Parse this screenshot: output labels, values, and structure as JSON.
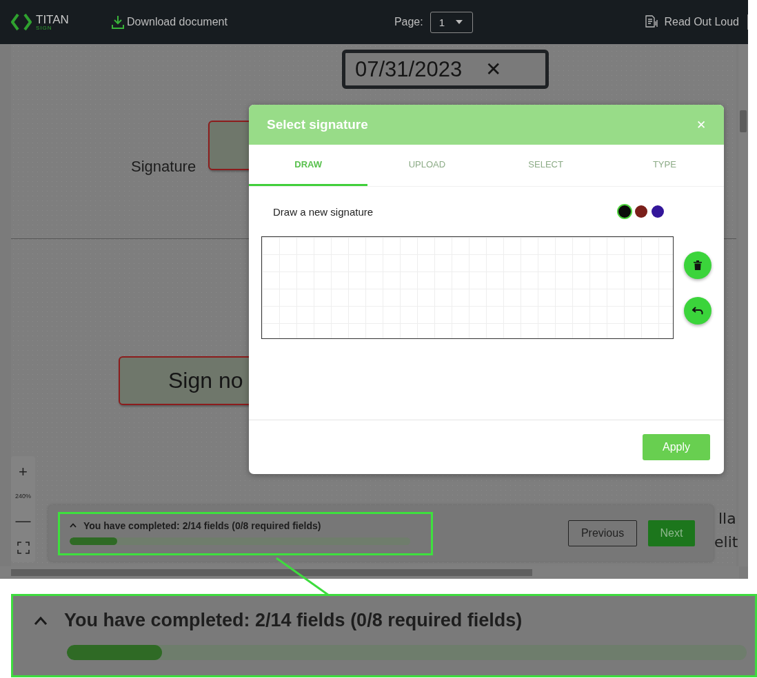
{
  "header": {
    "logo": {
      "name": "TITAN",
      "sub": "SIGN"
    },
    "download": "Download document",
    "page_label": "Page:",
    "page_value": "1",
    "read_aloud": "Read Out Loud"
  },
  "document": {
    "date_value": "07/31/2023",
    "date_clear": "✕",
    "signature_label": "Signature",
    "sign_button": "Sign no",
    "fragments": [
      "lla",
      "elit"
    ]
  },
  "zoom": {
    "plus": "+",
    "level": "240%",
    "minus": "—"
  },
  "modal": {
    "title": "Select signature",
    "close": "✕",
    "tabs": [
      {
        "label": "DRAW",
        "selected": true
      },
      {
        "label": "UPLOAD",
        "selected": false
      },
      {
        "label": "SELECT",
        "selected": false
      },
      {
        "label": "TYPE",
        "selected": false
      }
    ],
    "prompt": "Draw a new signature",
    "colors": [
      {
        "color": "#0a0a0a",
        "selected": true
      },
      {
        "color": "#7a1f1a",
        "selected": false
      },
      {
        "color": "#33169a",
        "selected": false
      }
    ],
    "apply": "Apply"
  },
  "progress": {
    "text": "You have completed: 2/14 fields (0/8 required fields)",
    "level": 0.14,
    "previous": "Previous",
    "next": "Next"
  },
  "callout": {
    "text": "You have completed: 2/14 fields (0/8 required fields)",
    "level": 0.14
  }
}
